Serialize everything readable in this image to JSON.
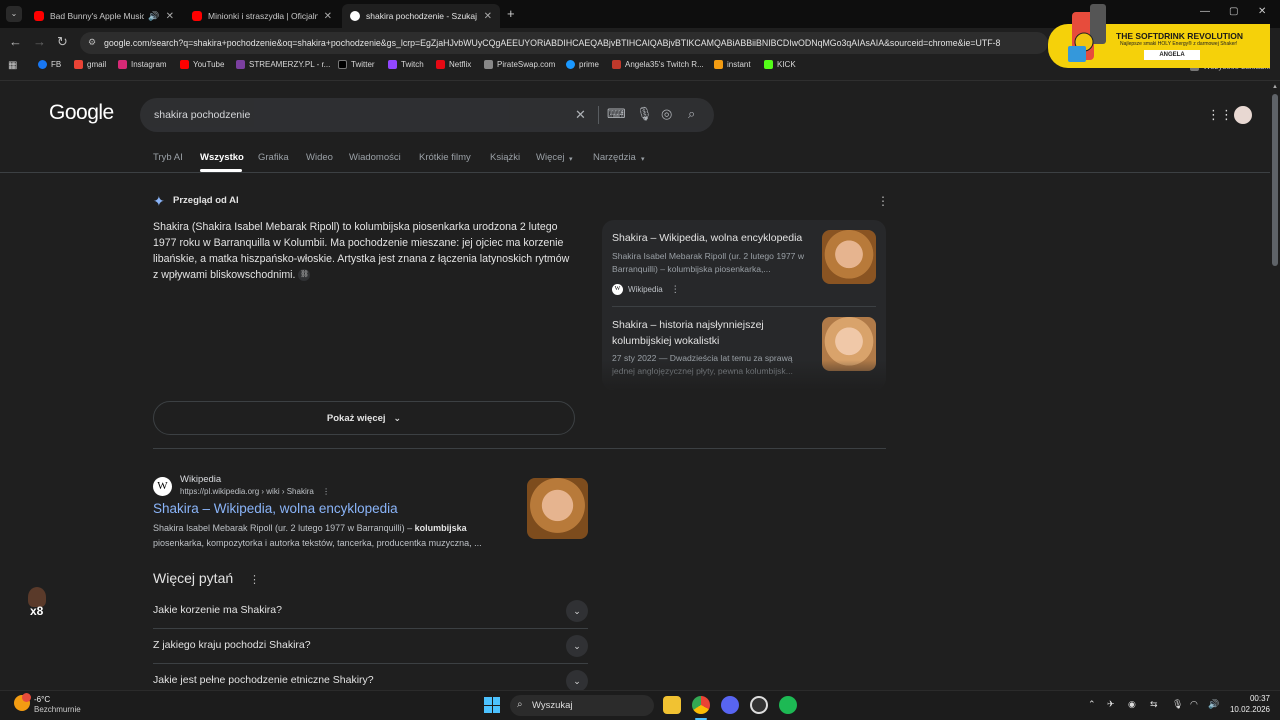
{
  "tabs": [
    {
      "title": "Bad Bunny's Apple Music S",
      "color": "#ff0000"
    },
    {
      "title": "Minionki i straszydła | Oficjalny",
      "color": "#ff0000"
    },
    {
      "title": "shakira pochodzenie - Szukaj w",
      "color": "#4285f4"
    }
  ],
  "address_bar": {
    "url": "google.com/search?q=shakira+pochodzenie&oq=shakira+pochodzenie&gs_lcrp=EgZjaHJvbWUyCQgAEEUYORiABDIHCAEQABjvBTIHCAIQABjvBTIKCAMQABiABBiiBNIBCDIwODNqMGo3qAIAsAIA&sourceid=chrome&ie=UTF-8"
  },
  "bookmarks": [
    "FB",
    "gmail",
    "Instagram",
    "YouTube",
    "STREAMERZY.PL - r...",
    "Twitter",
    "Twitch",
    "Netflix",
    "PirateSwap.com",
    "prime",
    "Angela35's Twitch R...",
    "instant",
    "KICK"
  ],
  "bookmarks_folder": "Wszystkie zakładki",
  "promo": {
    "title": "THE SOFTDRINK REVOLUTION",
    "subtitle": "Najlepsze smaki HOLY Energy® z darmowej Shaker!",
    "name": "ANGELA"
  },
  "search": {
    "logo": "Google",
    "query": "shakira pochodzenie"
  },
  "nav_tabs": [
    "Tryb AI",
    "Wszystko",
    "Grafika",
    "Wideo",
    "Wiadomości",
    "Krótkie filmy",
    "Książki",
    "Więcej",
    "Narzędzia"
  ],
  "ai_overview": {
    "title": "Przegląd od AI",
    "text": "Shakira (Shakira Isabel Mebarak Ripoll) to kolumbijska piosenkarka urodzona 2 lutego 1977 roku w Barranquilla w Kolumbii. Ma pochodzenie mieszane: jej ojciec ma korzenie libańskie, a matka hiszpańsko-włoskie. Artystka jest znana z łączenia latynoskich rytmów z wpływami bliskowschodnimi.",
    "show_more": "Pokaż więcej",
    "sources": [
      {
        "title": "Shakira – Wikipedia, wolna encyklopedia",
        "snippet": "Shakira Isabel Mebarak Ripoll (ur. 2 lutego 1977 w Barranquilli) – kolumbijska piosenkarka,...",
        "site": "Wikipedia"
      },
      {
        "title": "Shakira – historia najsłynniejszej kolumbijskiej wokalistki",
        "snippet": "27 sty 2022 — Dwadzieścia lat temu za sprawą jednej anglojęzycznej płyty, pewna kolumbijsk..."
      }
    ]
  },
  "result": {
    "site": "Wikipedia",
    "url": "https://pl.wikipedia.org › wiki › Shakira",
    "title": "Shakira – Wikipedia, wolna encyklopedia",
    "snippet_a": "Shakira Isabel Mebarak Ripoll (ur. 2 lutego 1977 w Barranquilli) – ",
    "snippet_bold": "kolumbijska",
    "snippet_b": " piosenkarka, kompozytorka i autorka tekstów, tancerka, producentka muzyczna, ..."
  },
  "paa": {
    "title": "Więcej pytań",
    "questions": [
      "Jakie korzenie ma Shakira?",
      "Z jakiego kraju pochodzi Shakira?",
      "Jakie jest pełne pochodzenie etniczne Shakiry?"
    ]
  },
  "taskbar": {
    "weather_temp": "-6°C",
    "weather_cond": "Bezchmurnie",
    "search_placeholder": "Wyszukaj",
    "time": "00:37",
    "date": "10.02.2026"
  },
  "sticker_label": "x8"
}
